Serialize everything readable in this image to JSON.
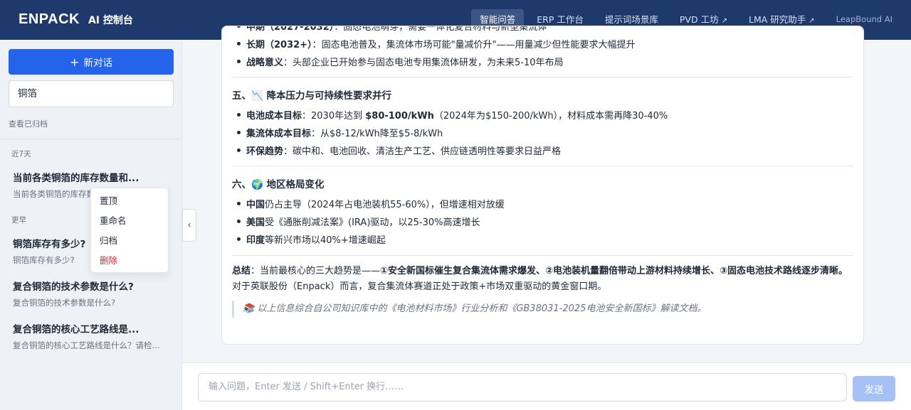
{
  "header": {
    "logo_text": "ENPACK",
    "app_title": "AI 控制台",
    "nav": [
      {
        "label": "智能问答",
        "active": true,
        "external": false
      },
      {
        "label": "ERP 工作台",
        "active": false,
        "external": false
      },
      {
        "label": "提示词场景库",
        "active": false,
        "external": false
      },
      {
        "label": "PVD 工坊",
        "active": false,
        "external": true
      },
      {
        "label": "LMA 研究助手",
        "active": false,
        "external": true
      },
      {
        "label": "LeapBound AI",
        "active": false,
        "external": false
      }
    ],
    "external_icon": "↗"
  },
  "sidebar": {
    "new_chat_label": "新对话",
    "new_chat_icon": "+",
    "search_value": "铜箔",
    "archived_link": "查看已归档",
    "groups": {
      "recent_label": "近7天",
      "earlier_label": "更早"
    },
    "conversations": [
      {
        "title": "当前各类铜箔的库存数量和...",
        "subtitle": "当前各类铜箔的库存数量和..."
      },
      {
        "title": "铜箔库存有多少?",
        "subtitle": "铜箔库存有多少?"
      },
      {
        "title": "复合铜箔的技术参数是什么?",
        "subtitle": "复合铜箔的技术参数是什么?"
      },
      {
        "title": "复合铜箔的核心工艺路线是...",
        "subtitle": "复合铜箔的核心工艺路线是什么？请检..."
      }
    ],
    "context_menu": [
      "置顶",
      "重命名",
      "归档",
      "删除"
    ],
    "collapse_icon": "‹"
  },
  "answer": {
    "rows": [
      {
        "bold": "中期（2027-2032）",
        "text": "：固态电池萌芽，需要一体化复合材料与新型集流体"
      },
      {
        "bold": "长期（2032+）",
        "text": "：固态电池普及，集流体市场可能\"量减价升\"——用量减少但性能要求大幅提升"
      },
      {
        "bold": "战略意义",
        "text": "：头部企业已开始参与固态电池专用集流体研发，为未来5-10年布局"
      }
    ],
    "section5": {
      "title": "五、📉 降本压力与可持续性要求并行",
      "items": [
        {
          "bold": "电池成本目标",
          "text_a": "：2030年达到 ",
          "bold2": "$80-100/kWh",
          "text_b": "（2024年为$150-200/kWh），材料成本需再降30-40%"
        },
        {
          "bold": "集流体成本目标",
          "text_a": "：从$8-12/kWh降至$5-8/kWh",
          "bold2": "",
          "text_b": ""
        },
        {
          "bold": "环保趋势",
          "text_a": "：碳中和、电池回收、清洁生产工艺、供应链透明性等要求日益严格",
          "bold2": "",
          "text_b": ""
        }
      ]
    },
    "section6": {
      "title": "六、🌍 地区格局变化",
      "items": [
        {
          "bold": "中国",
          "text": "仍占主导（2024年占电池装机55-60%），但增速相对放缓"
        },
        {
          "bold": "美国",
          "text": "受《通胀削减法案》(IRA)驱动，以25-30%高速增长"
        },
        {
          "bold": "印度",
          "text": "等新兴市场以40%+增速崛起"
        }
      ]
    },
    "summary": {
      "label": "总结",
      "lead": "：当前最核心的三大趋势是——",
      "highlight": "①安全新国标催生复合集流体需求爆发、②电池装机量翻倍带动上游材料持续增长、③固态电池技术路线逐步清晰。",
      "tail": "对于英联股份（Enpack）而言，复合集流体赛道正处于政策+市场双重驱动的黄金窗口期。"
    },
    "source_note": "📚 以上信息综合自公司知识库中的《电池材料市场》行业分析和《GB38031-2025电池安全新国标》解读文档。"
  },
  "composer": {
    "placeholder": "输入问题，Enter 发送 / Shift+Enter 换行……",
    "send_label": "发送"
  }
}
